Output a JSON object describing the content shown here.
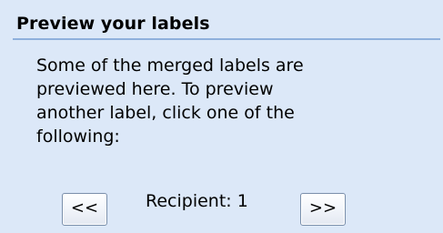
{
  "section": {
    "title": "Preview your labels"
  },
  "description": {
    "line1": "Some of the merged labels are",
    "line2": "previewed here. To preview",
    "line3": "another label, click one of the",
    "line4": "following:"
  },
  "navigation": {
    "prev_label": "<<",
    "next_label": ">>",
    "recipient_text": "Recipient: 1"
  },
  "colors": {
    "pane_background": "#dce8f8",
    "rule": "#8fb0dc"
  }
}
